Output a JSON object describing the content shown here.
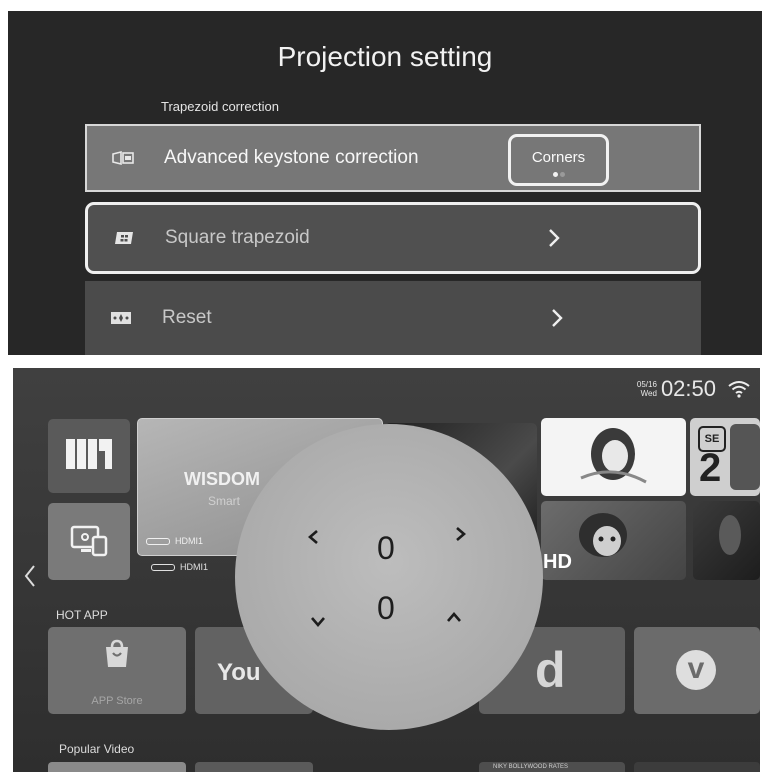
{
  "projection": {
    "title": "Projection setting",
    "section_label": "Trapezoid correction",
    "rows": [
      {
        "label": "Advanced keystone correction",
        "icon": "keystone-icon",
        "value": "Corners"
      },
      {
        "label": "Square trapezoid",
        "icon": "square-trapezoid-icon"
      },
      {
        "label": "Reset",
        "icon": "reset-icon"
      }
    ]
  },
  "home": {
    "status": {
      "date": "05/16",
      "weekday": "Wed",
      "time": "02:50",
      "wifi_icon": "wifi-icon"
    },
    "featured": {
      "title": "WISDOM",
      "subtitle": "Smart",
      "hdmi_labels": [
        "HDMI1",
        "HDMI1"
      ]
    },
    "poster_badges": {
      "hd": "HD",
      "season": "SE",
      "season_number": "2"
    },
    "sections": {
      "hot_app": "HOT APP",
      "popular_video": "Popular Video"
    },
    "apps": [
      {
        "label": "APP Store",
        "icon": "app-store-icon"
      },
      {
        "label": "You",
        "icon": "youtube-icon"
      },
      {
        "label": "d",
        "icon": "dailymotion-icon"
      },
      {
        "label": "v",
        "icon": "vimeo-icon"
      }
    ],
    "keystone": {
      "top_value": "0",
      "bottom_value": "0"
    },
    "popular_caption": "NIKY BOLLYWOOD RATES"
  },
  "colors": {
    "panel": "#272727",
    "row_selected": "#777777",
    "row": "#505050"
  }
}
